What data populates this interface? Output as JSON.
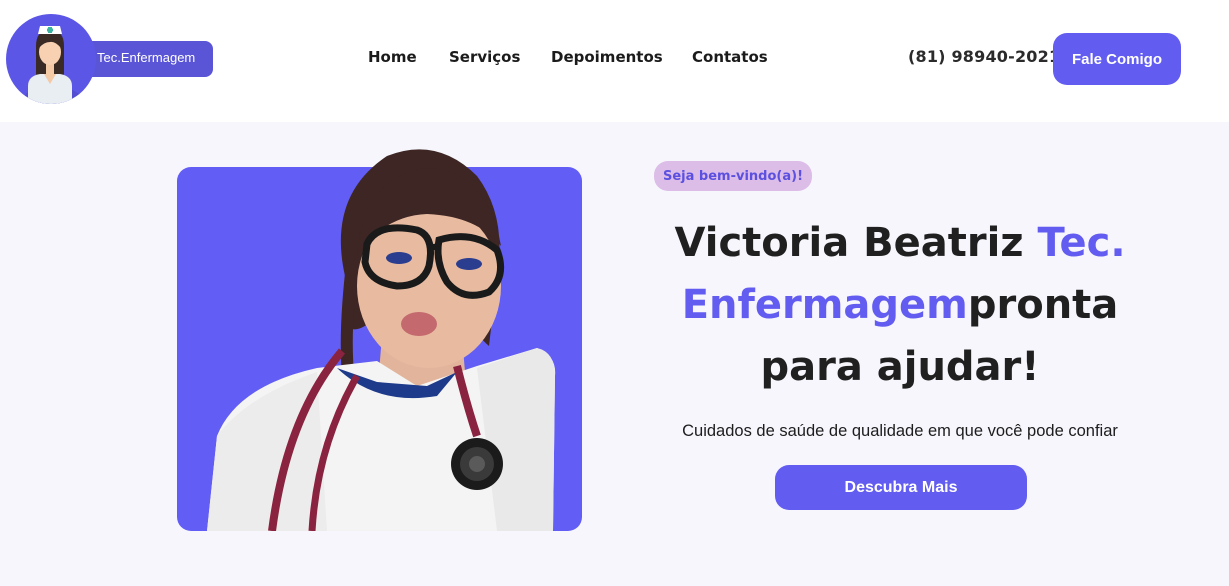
{
  "brand": {
    "name": "Tec.Enfermagem",
    "logo_icon": "nurse-avatar-icon",
    "accent_color": "#625df0"
  },
  "nav": {
    "items": [
      {
        "label": "Home"
      },
      {
        "label": "Serviços"
      },
      {
        "label": "Depoimentos"
      },
      {
        "label": "Contatos"
      }
    ]
  },
  "header": {
    "phone": "(81) 98940-2021",
    "cta_label": "Fale Comigo"
  },
  "hero": {
    "badge": "Seja bem-vindo(a)!",
    "headline_part1": "Victoria Beatriz ",
    "headline_accent": "Tec. Enfermagem",
    "headline_part2": "pronta para ajudar!",
    "subtitle": "Cuidados de saúde de qualidade em que você pode confiar",
    "button_label": "Descubra Mais",
    "photo_bg_color": "#625df4"
  }
}
